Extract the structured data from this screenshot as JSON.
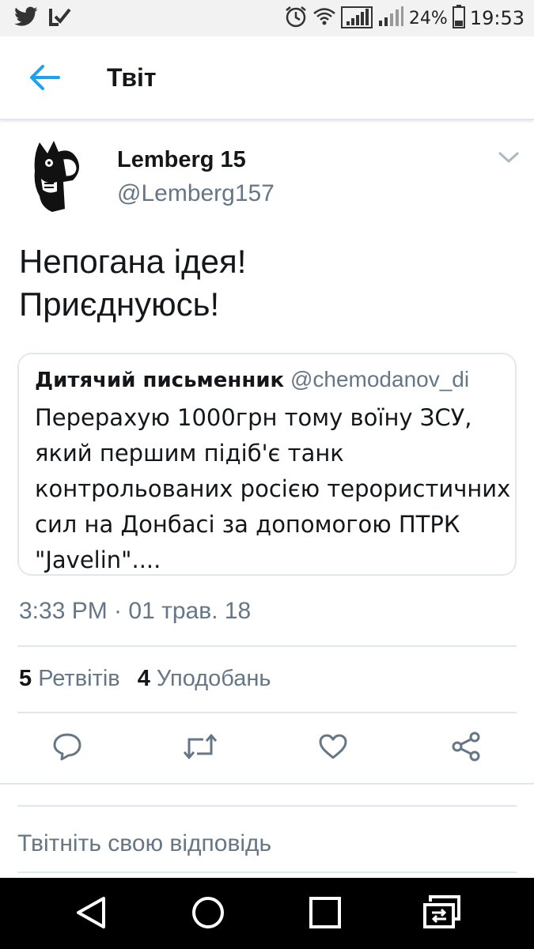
{
  "status_bar": {
    "battery": "24%",
    "time": "19:53",
    "icons": [
      "twitter-icon",
      "check-app-icon",
      "alarm-icon",
      "wifi-icon",
      "signal-icon",
      "signal-2-icon",
      "battery-icon"
    ]
  },
  "header": {
    "title": "Твіт",
    "back_icon": "arrow-left-icon"
  },
  "tweet": {
    "author_name": "Lemberg 15",
    "author_handle": "@Lemberg157",
    "text_lines": [
      "Непогана ідея!",
      "Приєднуюсь!"
    ],
    "timestamp": "3:33 PM · 01 трав. 18",
    "retweets_count": "5",
    "retweets_label": "Ретвітів",
    "likes_count": "4",
    "likes_label": "Уподобань"
  },
  "quoted_tweet": {
    "author_name": "Дитячий письменник",
    "author_handle": "@chemodanov_di",
    "text_lines": [
      "Перерахую 1000грн тому воїну ЗСУ,",
      "який першим підіб'є танк",
      "контрольованих росією терористичних",
      "сил на Донбасі за допомогою ПТРК",
      "\"Javelin\"...."
    ]
  },
  "actions": [
    "reply-icon",
    "retweet-icon",
    "like-icon",
    "share-icon"
  ],
  "reply": {
    "placeholder": "Твітніть свою відповідь"
  },
  "colors": {
    "accent": "#1da1f2",
    "secondary_text": "#657786",
    "divider": "#e1e8ed",
    "primary_text": "#14171a"
  }
}
